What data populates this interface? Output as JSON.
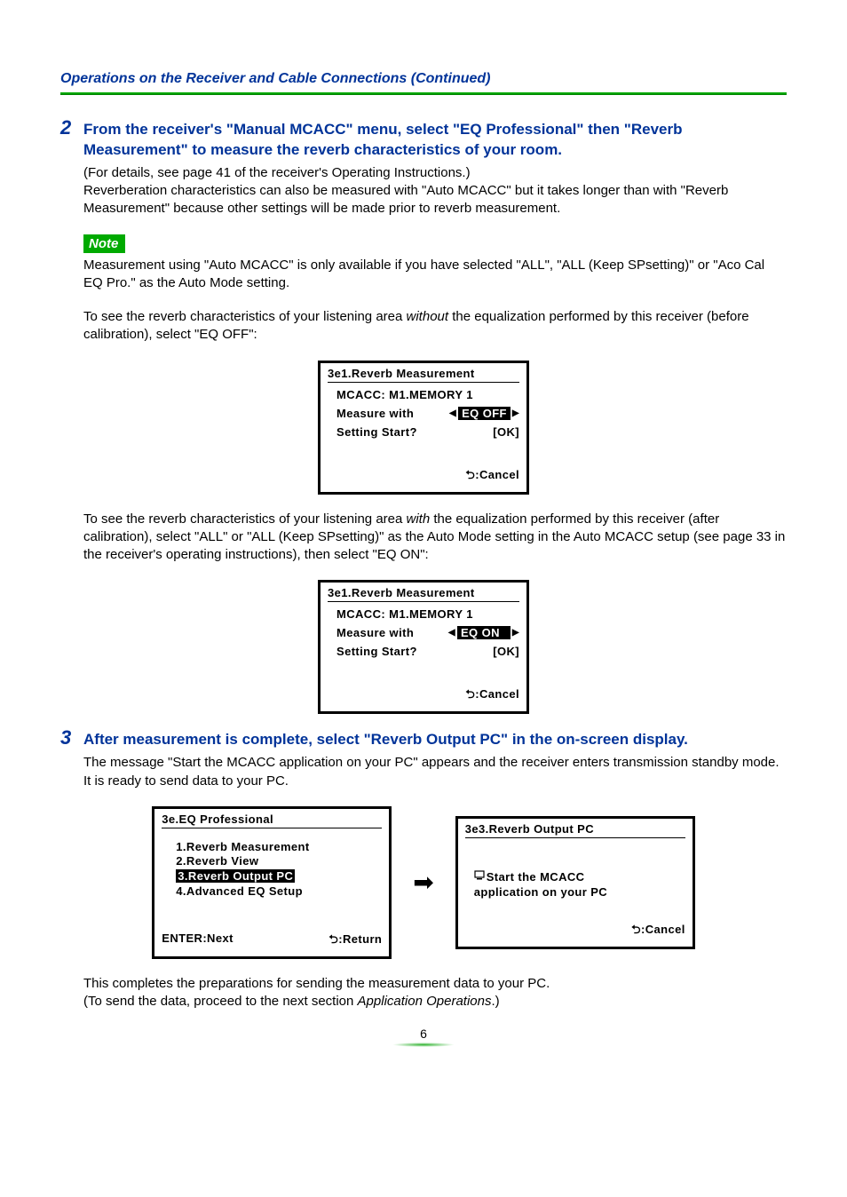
{
  "header": {
    "title": "Operations on the Receiver and Cable Connections (Continued)"
  },
  "step2": {
    "num": "2",
    "heading": "From the receiver's \"Manual MCACC\" menu, select \"EQ Professional\" then \"Reverb Measurement\" to measure the reverb characteristics of your room.",
    "para1": "(For details, see page 41 of the receiver's Operating Instructions.)",
    "para2": "Reverberation characteristics can also be measured with \"Auto MCACC\" but it takes longer than with \"Reverb Measurement\" because other settings will be made prior to reverb measurement."
  },
  "note": {
    "label": "Note",
    "text": "Measurement using \"Auto MCACC\" is only available if you have selected \"ALL\", \"ALL (Keep SPsetting)\" or \"Aco Cal EQ Pro.\" as the Auto Mode setting."
  },
  "eqoff_intro_a": "To see the reverb characteristics of your listening area ",
  "eqoff_intro_without": "without",
  "eqoff_intro_b": " the equalization performed by this receiver (before calibration), select \"EQ OFF\":",
  "osd1": {
    "title": "3e1.Reverb  Measurement",
    "mcacc": "MCACC: M1.MEMORY 1",
    "measure": "Measure with",
    "eq": "EQ OFF",
    "start": "Setting  Start?",
    "ok": "[OK]",
    "cancel": ":Cancel"
  },
  "eqon_intro_a": "To see the reverb characteristics of your listening area ",
  "eqon_intro_with": "with",
  "eqon_intro_b": " the equalization performed by this receiver (after calibration), select \"ALL\" or \"ALL (Keep SPsetting)\" as the Auto Mode setting in the Auto MCACC setup (see page 33 in the receiver's operating instructions), then select \"EQ ON\":",
  "osd2": {
    "title": "3e1.Reverb  Measurement",
    "mcacc": "MCACC: M1.MEMORY 1",
    "measure": "Measure with",
    "eq": "EQ ON",
    "start": "Setting  Start?",
    "ok": "[OK]",
    "cancel": ":Cancel"
  },
  "step3": {
    "num": "3",
    "heading": "After measurement is complete, select \"Reverb Output PC\" in the on-screen display.",
    "para": "The message \"Start the MCACC application on your PC\" appears and the receiver enters transmission standby mode. It is ready to send data to your PC."
  },
  "osd3": {
    "title": "3e.EQ  Professional",
    "items": [
      "1.Reverb  Measurement",
      "2.Reverb  View",
      "3.Reverb  Output  PC",
      "4.Advanced  EQ  Setup"
    ],
    "enter": "ENTER:Next",
    "return": ":Return"
  },
  "osd4": {
    "title": "3e3.Reverb  Output  PC",
    "msg1": "Start the MCACC",
    "msg2": "application on your PC",
    "cancel": ":Cancel"
  },
  "closing": {
    "line1": "This completes the preparations for sending the measurement data to your PC.",
    "line2a": "(To send the data, proceed to the next section ",
    "line2_ital": "Application Operations",
    "line2b": ".)"
  },
  "pagenum": "6"
}
